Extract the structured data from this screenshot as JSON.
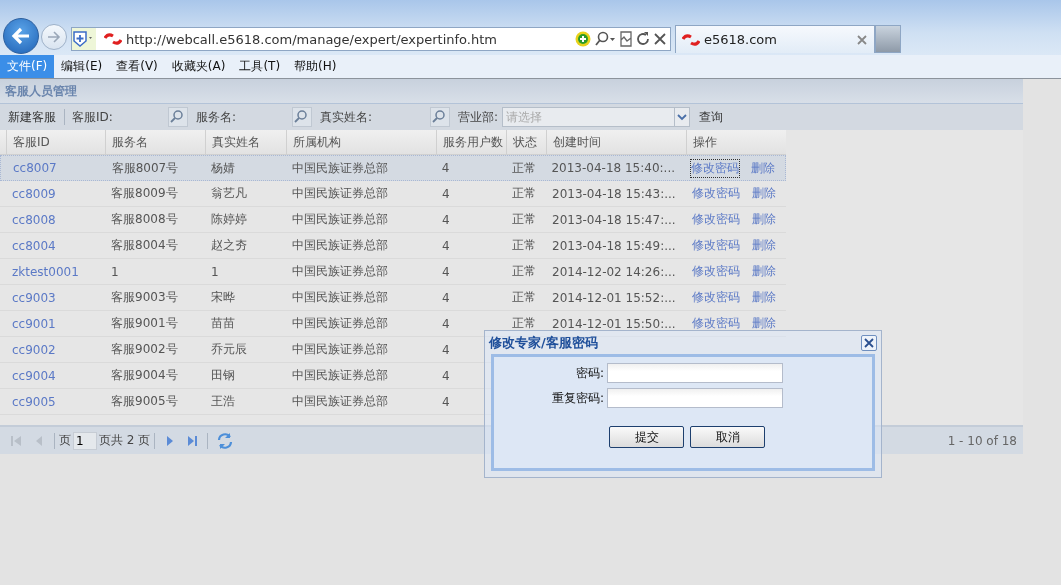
{
  "browser": {
    "address": "http://webcall.e5618.com/manage/expert/expertinfo.htm",
    "tab_title": "e5618.com"
  },
  "menu": [
    {
      "label": "文件(F)",
      "selected": true
    },
    {
      "label": "编辑(E)",
      "selected": false
    },
    {
      "label": "查看(V)",
      "selected": false
    },
    {
      "label": "收藏夹(A)",
      "selected": false
    },
    {
      "label": "工具(T)",
      "selected": false
    },
    {
      "label": "帮助(H)",
      "selected": false
    }
  ],
  "panel": {
    "title": "客服人员管理",
    "toolbar": {
      "new_button": "新建客服",
      "filters": [
        {
          "label": "客服ID:"
        },
        {
          "label": "服务名:"
        },
        {
          "label": "真实姓名:"
        }
      ],
      "dept_label": "营业部:",
      "dept_placeholder": "请选择",
      "query_button": "查询"
    },
    "table": {
      "columns": [
        "客服ID",
        "服务名",
        "真实姓名",
        "所属机构",
        "服务用户数",
        "状态",
        "创建时间",
        "操作"
      ],
      "rows": [
        {
          "selected": true,
          "id": "cc8007",
          "service": "客服8007号",
          "name": "杨婧",
          "org": "中国民族证券总部",
          "count": "4",
          "status": "正常",
          "time": "2013-04-18 15:40:...",
          "actions": [
            "修改密码",
            "删除"
          ]
        },
        {
          "selected": false,
          "id": "cc8009",
          "service": "客服8009号",
          "name": "翁艺凡",
          "org": "中国民族证券总部",
          "count": "4",
          "status": "正常",
          "time": "2013-04-18 15:43:...",
          "actions": [
            "修改密码",
            "删除"
          ]
        },
        {
          "selected": false,
          "id": "cc8008",
          "service": "客服8008号",
          "name": "陈婷婷",
          "org": "中国民族证券总部",
          "count": "4",
          "status": "正常",
          "time": "2013-04-18 15:47:...",
          "actions": [
            "修改密码",
            "删除"
          ]
        },
        {
          "selected": false,
          "id": "cc8004",
          "service": "客服8004号",
          "name": "赵之夯",
          "org": "中国民族证券总部",
          "count": "4",
          "status": "正常",
          "time": "2013-04-18 15:49:...",
          "actions": [
            "修改密码",
            "删除"
          ]
        },
        {
          "selected": false,
          "id": "zktest0001",
          "service": "1",
          "name": "1",
          "org": "中国民族证券总部",
          "count": "4",
          "status": "正常",
          "time": "2014-12-02 14:26:...",
          "actions": [
            "修改密码",
            "删除"
          ]
        },
        {
          "selected": false,
          "id": "cc9003",
          "service": "客服9003号",
          "name": "宋晔",
          "org": "中国民族证券总部",
          "count": "4",
          "status": "正常",
          "time": "2014-12-01 15:52:...",
          "actions": [
            "修改密码",
            "删除"
          ]
        },
        {
          "selected": false,
          "id": "cc9001",
          "service": "客服9001号",
          "name": "苗苗",
          "org": "中国民族证券总部",
          "count": "4",
          "status": "正常",
          "time": "2014-12-01 15:50:...",
          "actions": [
            "修改密码",
            "删除"
          ]
        },
        {
          "selected": false,
          "id": "cc9002",
          "service": "客服9002号",
          "name": "乔元辰",
          "org": "中国民族证券总部",
          "count": "4"
        },
        {
          "selected": false,
          "id": "cc9004",
          "service": "客服9004号",
          "name": "田钢",
          "org": "中国民族证券总部",
          "count": "4"
        },
        {
          "selected": false,
          "id": "cc9005",
          "service": "客服9005号",
          "name": "王浩",
          "org": "中国民族证券总部",
          "count": "4"
        }
      ]
    },
    "pager": {
      "page_label": "页",
      "page_value": "1",
      "total": "页共 2 页",
      "range": "1 - 10 of 18"
    }
  },
  "dialog": {
    "title": "修改专家/客服密码",
    "fields": [
      {
        "label": "密码:"
      },
      {
        "label": "重复密码:"
      }
    ],
    "buttons": [
      "提交",
      "取消"
    ]
  }
}
